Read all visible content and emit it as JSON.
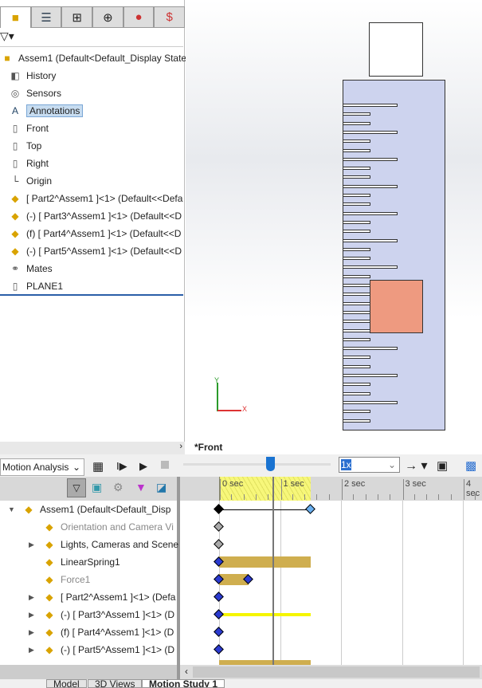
{
  "feature_tree": {
    "tabs": [
      "feature-manager",
      "property-manager",
      "configuration-manager",
      "dimxpert-manager",
      "display-manager",
      "cam-manager"
    ],
    "root": "Assem1  (Default<Default_Display State-1",
    "items": [
      {
        "label": "History",
        "icon": "history-icon"
      },
      {
        "label": "Sensors",
        "icon": "sensors-icon"
      },
      {
        "label": "Annotations",
        "icon": "annotations-icon",
        "selected": true
      },
      {
        "label": "Front",
        "icon": "plane-icon"
      },
      {
        "label": "Top",
        "icon": "plane-icon"
      },
      {
        "label": "Right",
        "icon": "plane-icon"
      },
      {
        "label": "Origin",
        "icon": "origin-icon"
      },
      {
        "label": "[ Part2^Assem1 ]<1> (Default<<Defa",
        "icon": "part-icon"
      },
      {
        "label": "(-) [ Part3^Assem1 ]<1> (Default<<D",
        "icon": "part-icon"
      },
      {
        "label": "(f) [ Part4^Assem1 ]<1> (Default<<D",
        "icon": "part-icon"
      },
      {
        "label": "(-) [ Part5^Assem1 ]<1> (Default<<D",
        "icon": "part-icon"
      },
      {
        "label": "Mates",
        "icon": "mates-icon"
      },
      {
        "label": "PLANE1",
        "icon": "plane-icon"
      }
    ]
  },
  "viewport": {
    "view_name": "*Front",
    "axis_x": "X",
    "axis_y": "Y",
    "colors": {
      "ruler": "#cdd3ee",
      "slider": "#ee9a80"
    }
  },
  "motion": {
    "study_type": "Motion Analysis",
    "playback_speed": "1x",
    "time_labels": [
      "0 sec",
      "1 sec",
      "2 sec",
      "3 sec",
      "4 sec"
    ],
    "playhead_sec": 0.88,
    "duration_sec": 1.5,
    "rows": [
      {
        "label": "Assem1  (Default<Default_Disp",
        "expand": "open",
        "gray": false
      },
      {
        "label": "Orientation and Camera Vi",
        "gray": true
      },
      {
        "label": "Lights, Cameras and Scene",
        "expand": "closed",
        "gray": false
      },
      {
        "label": "LinearSpring1",
        "gray": false
      },
      {
        "label": "Force1",
        "gray": true
      },
      {
        "label": "[ Part2^Assem1 ]<1> (Defa",
        "expand": "closed",
        "gray": false
      },
      {
        "label": "(-) [ Part3^Assem1 ]<1> (D",
        "expand": "closed",
        "gray": false
      },
      {
        "label": "(f) [ Part4^Assem1 ]<1> (D",
        "expand": "closed",
        "gray": false
      },
      {
        "label": "(-) [ Part5^Assem1 ]<1> (D",
        "expand": "closed",
        "gray": false
      }
    ]
  },
  "bottom_tabs": [
    "Model",
    "3D Views",
    "Motion Study 1"
  ]
}
